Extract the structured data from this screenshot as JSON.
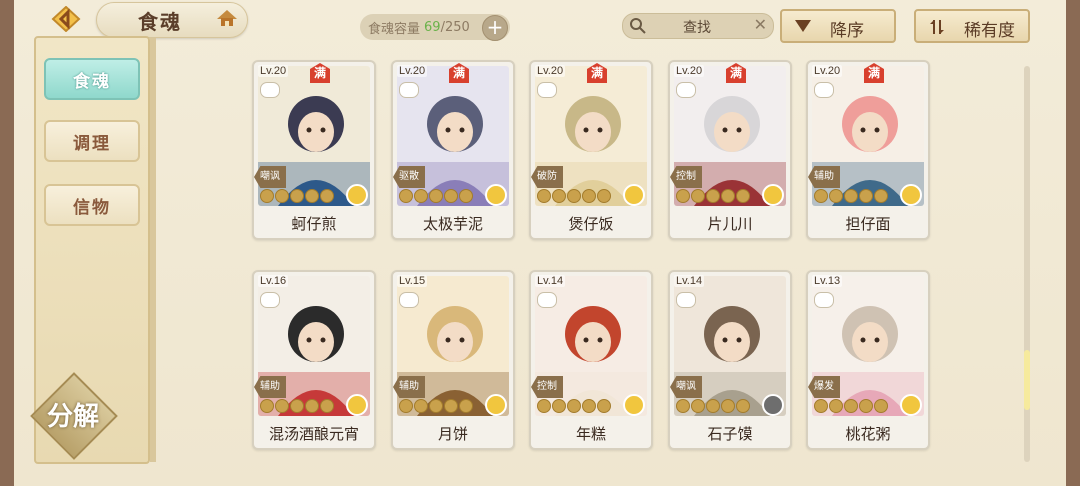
{
  "header": {
    "title": "食魂",
    "capacity_label": "食魂容量",
    "capacity_current": "69",
    "capacity_max": "/250",
    "search_placeholder": "查找",
    "sort_order_label": "降序",
    "sort_by_label": "稀有度"
  },
  "sidebar": {
    "tabs": [
      {
        "label": "食魂",
        "active": true
      },
      {
        "label": "调理",
        "active": false
      },
      {
        "label": "信物",
        "active": false
      }
    ],
    "decompose_label": "分解"
  },
  "full_mark": "满",
  "cards": [
    {
      "level": "Lv.20",
      "name": "蚵仔煎",
      "role": "嘲讽",
      "full": true,
      "gold": true,
      "palette": [
        "#f0ead8",
        "#3b3b52",
        "#2d5a8a"
      ]
    },
    {
      "level": "Lv.20",
      "name": "太极芋泥",
      "role": "驱散",
      "full": true,
      "gold": true,
      "palette": [
        "#e6e4ef",
        "#5b5f7a",
        "#8a7fb8"
      ]
    },
    {
      "level": "Lv.20",
      "name": "煲仔饭",
      "role": "破防",
      "full": true,
      "gold": true,
      "palette": [
        "#f5ecd6",
        "#c8b888",
        "#e1cf9c"
      ]
    },
    {
      "level": "Lv.20",
      "name": "片儿川",
      "role": "控制",
      "full": true,
      "gold": true,
      "palette": [
        "#f2eeee",
        "#d8d6d8",
        "#9a3436"
      ]
    },
    {
      "level": "Lv.20",
      "name": "担仔面",
      "role": "辅助",
      "full": true,
      "gold": true,
      "palette": [
        "#f6efe6",
        "#ef9e9a",
        "#3f6a8a"
      ]
    },
    {
      "level": "Lv.16",
      "name": "混汤酒酿元宵",
      "role": "辅助",
      "full": false,
      "gold": true,
      "palette": [
        "#f3eee6",
        "#2b2b2b",
        "#c63a3a"
      ]
    },
    {
      "level": "Lv.15",
      "name": "月饼",
      "role": "辅助",
      "full": false,
      "gold": true,
      "palette": [
        "#f6ead0",
        "#d9b87a",
        "#8a6234"
      ]
    },
    {
      "level": "Lv.14",
      "name": "年糕",
      "role": "控制",
      "full": false,
      "gold": true,
      "palette": [
        "#f6ece4",
        "#c2452d",
        "#f2e6d8"
      ]
    },
    {
      "level": "Lv.14",
      "name": "石子馍",
      "role": "嘲讽",
      "full": false,
      "gold": false,
      "palette": [
        "#efe6da",
        "#7a6450",
        "#a8a08e"
      ]
    },
    {
      "level": "Lv.13",
      "name": "桃花粥",
      "role": "爆发",
      "full": false,
      "gold": true,
      "palette": [
        "#f6f0ea",
        "#cfc2b3",
        "#e7a8b8"
      ]
    }
  ],
  "colors": {
    "accent_teal": "#8fd8cc",
    "capacity_current": "#6ab24a",
    "full_mark": "#d8402e"
  }
}
